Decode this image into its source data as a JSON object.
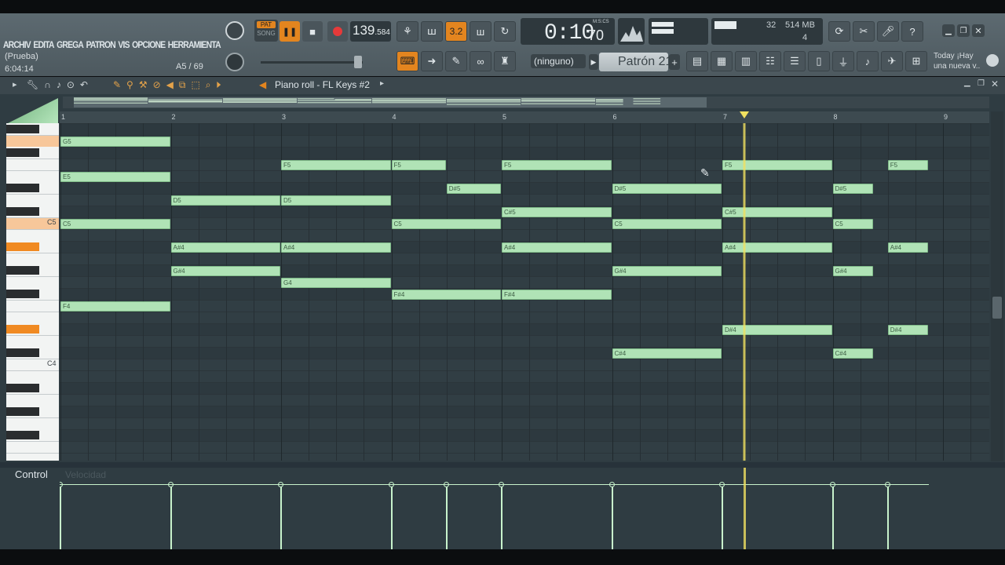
{
  "menu": [
    "ARCHIV",
    "EDITA",
    "GREGA",
    "PATRON",
    "VIS",
    "OPCIONE",
    "HERRAMIENTA"
  ],
  "project": {
    "name": "(Prueba)",
    "time": "6:04:14",
    "note_info": "A5 / 69"
  },
  "transport": {
    "pat_label": "PAT",
    "song_label": "SONG",
    "tempo_int": "139",
    "tempo_frac": ".584",
    "counter_main": "0:10",
    "counter_sub": "70",
    "counter_unit": "M:S:CS",
    "step_label": "3.2"
  },
  "monitor": {
    "cpu": "32",
    "ram": "514 MB",
    "poly": "4"
  },
  "channel": {
    "none_label": "(ninguno)",
    "pattern": "Patrón 21"
  },
  "news": {
    "line1": "Today ¡Hay",
    "line2": "una nueva v.."
  },
  "pianoroll": {
    "title": "Piano roll - FL Keys #2",
    "bars": [
      "1",
      "2",
      "3",
      "4",
      "5",
      "6",
      "7",
      "8",
      "9"
    ],
    "key_labels": [
      "C5",
      "C4"
    ],
    "control_label": "Control",
    "control_target": "Velocidad"
  },
  "colors": {
    "note": "#b0e3b6",
    "accent": "#e3851f",
    "playhead": "#f0e060",
    "background": "#313e44"
  },
  "notes": [
    {
      "pitch": "G5",
      "start": 1,
      "dur": 1
    },
    {
      "pitch": "E5",
      "start": 1,
      "dur": 1
    },
    {
      "pitch": "C5",
      "start": 1,
      "dur": 1
    },
    {
      "pitch": "F4",
      "start": 1,
      "dur": 1
    },
    {
      "pitch": "D5",
      "start": 2,
      "dur": 1
    },
    {
      "pitch": "A#4",
      "start": 2,
      "dur": 1
    },
    {
      "pitch": "G#4",
      "start": 2,
      "dur": 1
    },
    {
      "pitch": "F5",
      "start": 3,
      "dur": 1
    },
    {
      "pitch": "D5",
      "start": 3,
      "dur": 1
    },
    {
      "pitch": "A#4",
      "start": 3,
      "dur": 1
    },
    {
      "pitch": "G4",
      "start": 3,
      "dur": 1
    },
    {
      "pitch": "F5",
      "start": 4,
      "dur": 0.5
    },
    {
      "pitch": "C5",
      "start": 4,
      "dur": 1
    },
    {
      "pitch": "F#4",
      "start": 4,
      "dur": 1
    },
    {
      "pitch": "D#5",
      "start": 4.5,
      "dur": 0.5
    },
    {
      "pitch": "F5",
      "start": 5,
      "dur": 1
    },
    {
      "pitch": "C#5",
      "start": 5,
      "dur": 1
    },
    {
      "pitch": "A#4",
      "start": 5,
      "dur": 1
    },
    {
      "pitch": "F#4",
      "start": 5,
      "dur": 1
    },
    {
      "pitch": "D#5",
      "start": 6,
      "dur": 1
    },
    {
      "pitch": "C5",
      "start": 6,
      "dur": 1
    },
    {
      "pitch": "G#4",
      "start": 6,
      "dur": 1
    },
    {
      "pitch": "C#4",
      "start": 6,
      "dur": 1
    },
    {
      "pitch": "F5",
      "start": 7,
      "dur": 1
    },
    {
      "pitch": "C#5",
      "start": 7,
      "dur": 1
    },
    {
      "pitch": "A#4",
      "start": 7,
      "dur": 1
    },
    {
      "pitch": "D#4",
      "start": 7,
      "dur": 1
    },
    {
      "pitch": "D#5",
      "start": 8,
      "dur": 0.375
    },
    {
      "pitch": "C5",
      "start": 8,
      "dur": 0.375
    },
    {
      "pitch": "G#4",
      "start": 8,
      "dur": 0.375
    },
    {
      "pitch": "C#4",
      "start": 8,
      "dur": 0.375
    },
    {
      "pitch": "F5",
      "start": 8.5,
      "dur": 0.375
    },
    {
      "pitch": "A#4",
      "start": 8.5,
      "dur": 0.375
    },
    {
      "pitch": "D#4",
      "start": 8.5,
      "dur": 0.375
    }
  ],
  "playhead_bar": 7.2,
  "highlighted_keys": [
    "G5",
    "C5",
    "A#4",
    "D#4"
  ]
}
